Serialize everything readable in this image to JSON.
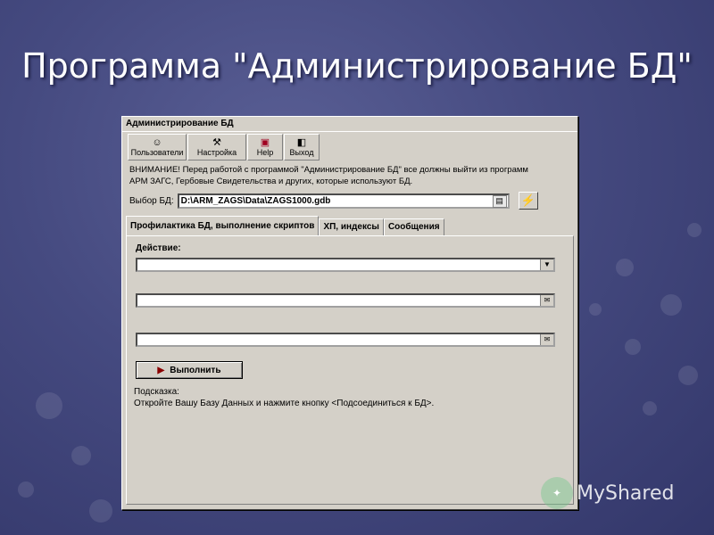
{
  "slide": {
    "title": "Программа \"Администрирование БД\"",
    "watermark": "MyShared"
  },
  "window": {
    "title": "Администрирование БД",
    "toolbar": [
      {
        "label": "Пользователи",
        "icon": "users-icon"
      },
      {
        "label": "Настройка",
        "icon": "tools-icon"
      },
      {
        "label": "Help",
        "icon": "book-icon"
      },
      {
        "label": "Выход",
        "icon": "exit-icon"
      }
    ],
    "warning_line1": "ВНИМАНИЕ!  Перед работой с программой \"Администрирование БД\" все должны выйти из программ",
    "warning_line2": "АРМ ЗАГС, Гербовые Свидетельства и других, которые используют БД.",
    "db_label": "Выбор БД:",
    "db_path": "D:\\ARM_ZAGS\\Data\\ZAGS1000.gdb",
    "tabs": [
      {
        "label": "Профилактика БД, выполнение скриптов",
        "active": true
      },
      {
        "label": "ХП, индексы",
        "active": false
      },
      {
        "label": "Сообщения",
        "active": false
      }
    ],
    "action_label": "Действие:",
    "action_value": "",
    "field2_value": "",
    "field3_value": "",
    "run_label": "Выполнить",
    "hint_title": "Подсказка:",
    "hint_text": "Откройте Вашу Базу Данных и нажмите кнопку <Подсоединиться к БД>."
  }
}
